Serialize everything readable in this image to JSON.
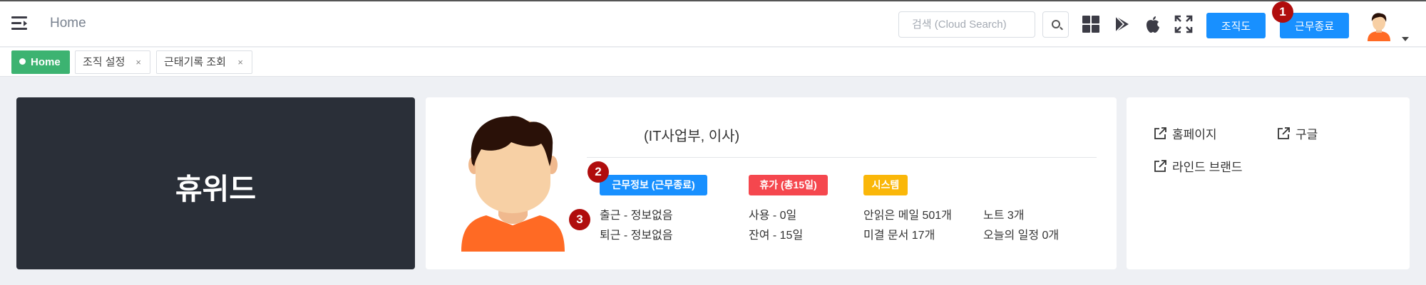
{
  "header": {
    "title": "Home",
    "search": {
      "placeholder": "검색 (Cloud Search)",
      "value": ""
    },
    "org_button_label": "조직도",
    "end_work_button_label": "근무종료",
    "icons": [
      "grid-icon",
      "google-play-icon",
      "apple-icon",
      "fullscreen-icon"
    ]
  },
  "tabs": [
    {
      "label": "Home",
      "active": true
    },
    {
      "label": "조직 설정",
      "close": "×"
    },
    {
      "label": "근태기록 조회",
      "close": "×"
    }
  ],
  "logo": {
    "text": "휴위드"
  },
  "profile": {
    "org_title": "(IT사업부, 이사)",
    "work_info": {
      "label": "근무정보 (근무종료)",
      "color": "#1890ff",
      "clock_in": "출근 - 정보없음",
      "clock_out": "퇴근 - 정보없음"
    },
    "vacation": {
      "label": "휴가 (총15일)",
      "color": "#f5474e",
      "used": "사용 - 0일",
      "remaining": "잔여 - 15일"
    },
    "system": {
      "label": "시스템",
      "color": "#fab709",
      "unread_mail": "안읽은 메일 501개",
      "pending_docs": "미결 문서 17개",
      "notes": "노트 3개",
      "today_schedule": "오늘의 일정 0개"
    }
  },
  "links": [
    {
      "label": "홈페이지"
    },
    {
      "label": "구글"
    },
    {
      "label": "라인드 브랜드"
    }
  ],
  "annotations": [
    "1",
    "2",
    "3"
  ],
  "colors": {
    "accent": "#1890ff",
    "home_tab": "#3cb371",
    "annotation": "#b00d0d",
    "logo_bg": "#2a2f38",
    "avatar_shirt": "#ff6a24"
  }
}
